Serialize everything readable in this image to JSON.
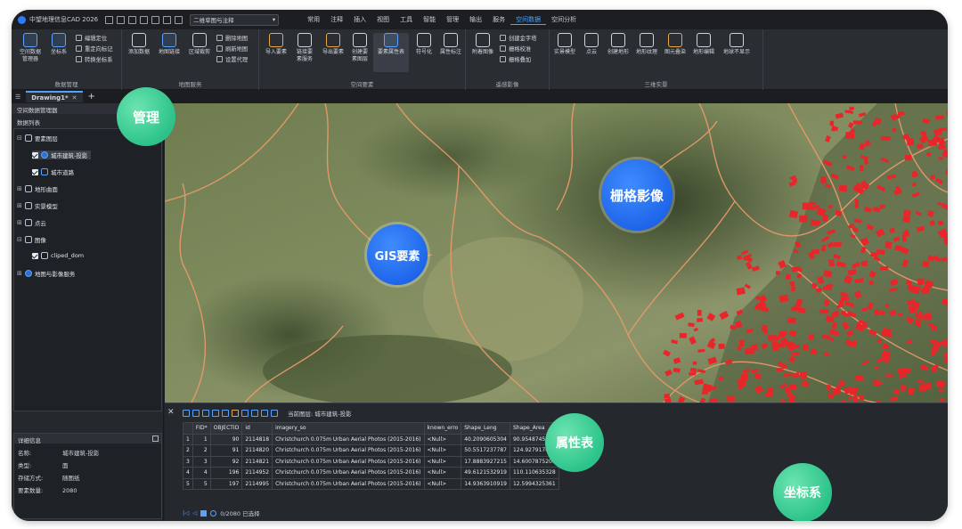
{
  "app": {
    "title": "中望地理信息CAD 2026"
  },
  "view_combo": {
    "value": "二维草图与注释"
  },
  "menu_tabs": [
    "常用",
    "注释",
    "插入",
    "视图",
    "工具",
    "智能",
    "管理",
    "输出",
    "服务",
    "空间数据",
    "空间分析"
  ],
  "active_menu": "空间数据",
  "ribbon": {
    "groups": [
      "数据管理",
      "地图服务",
      "空间要素",
      "遥感影像",
      "三维实景"
    ],
    "data_mgmt": {
      "btn1": "空间数据\n管理器",
      "btn2": "坐标系",
      "s1": "编辑定位",
      "s2": "重定向标记",
      "s3": "转换坐标系"
    },
    "map_service": {
      "btn1": "添加数据",
      "btn2": "地图链接",
      "btn3": "区域裁剪",
      "s1": "删除地图",
      "s2": "刷新地图",
      "s3": "设置代理"
    },
    "features": {
      "btn1": "导入要素",
      "btn2": "链接要\n素服务",
      "btn3": "导出要素",
      "btn4": "创建要\n素图层",
      "btn5": "要素属性表",
      "btn6": "符号化",
      "btn7": "属性标注"
    },
    "raster": {
      "btn1": "附着图像",
      "s1": "创建金字塔",
      "s2": "栅格校准",
      "s3": "栅格叠加"
    },
    "reality": {
      "btn1": "实景模型",
      "btn2": "点云",
      "btn3": "创建地形",
      "btn4": "地形纹理",
      "btn5": "图元叠染",
      "btn6": "地形编辑",
      "btn7": "地球不显示"
    }
  },
  "doc_tab": {
    "label": "Drawing1*"
  },
  "left_panel": {
    "header": "空间数据管理器",
    "subheader": "数据列表",
    "tree": [
      {
        "label": "要素图层"
      },
      {
        "label": "城市建筑-投影"
      },
      {
        "label": "城市道路"
      },
      {
        "label": "地形曲面"
      },
      {
        "label": "实景模型"
      },
      {
        "label": "点云"
      },
      {
        "label": "图像"
      },
      {
        "label": "cliped_dom"
      },
      {
        "label": "地图与影像服务"
      }
    ]
  },
  "details": {
    "header": "详细信息",
    "rows": [
      {
        "k": "名称:",
        "v": "城市建筑-投影"
      },
      {
        "k": "类型:",
        "v": "面"
      },
      {
        "k": "存储方式:",
        "v": "随图纸"
      },
      {
        "k": "要素数量:",
        "v": "2080"
      }
    ]
  },
  "attribute_table": {
    "current_layer_label": "当前图层:",
    "current_layer": "城市建筑-投影",
    "columns": [
      "FID*",
      "OBJECTID",
      "id",
      "imagery_so",
      "known_erro",
      "Shape_Leng",
      "Shape_Area"
    ],
    "rows": [
      [
        "1",
        "1",
        "90",
        "2114818",
        "Christchurch 0.075m Urban Aerial Photos (2015-2016)",
        "<Null>",
        "40.2090605304",
        "90.9548745673"
      ],
      [
        "2",
        "2",
        "91",
        "2114820",
        "Christchurch 0.075m Urban Aerial Photos (2015-2016)",
        "<Null>",
        "50.5517237787",
        "124.927917026"
      ],
      [
        "3",
        "3",
        "92",
        "2114821",
        "Christchurch 0.075m Urban Aerial Photos (2015-2016)",
        "<Null>",
        "17.8883927215",
        "14.6007875208"
      ],
      [
        "4",
        "4",
        "196",
        "2114952",
        "Christchurch 0.075m Urban Aerial Photos (2015-2016)",
        "<Null>",
        "49.6121532919",
        "110.110635328"
      ],
      [
        "5",
        "5",
        "197",
        "2114995",
        "Christchurch 0.075m Urban Aerial Photos (2015-2016)",
        "<Null>",
        "14.9363910919",
        "12.5994325361"
      ]
    ],
    "footer": "0/2080 已选择"
  },
  "bubbles": {
    "manage": "管理",
    "raster": "栅格影像",
    "gis": "GIS要素",
    "attr": "属性表",
    "coord": "坐标系"
  },
  "colors": {
    "accent": "#4da3ff",
    "green_bubble": "#2cc38a",
    "blue_bubble": "#1d63e8",
    "roads": "#e59a6a",
    "buildings": "#e8262a"
  }
}
